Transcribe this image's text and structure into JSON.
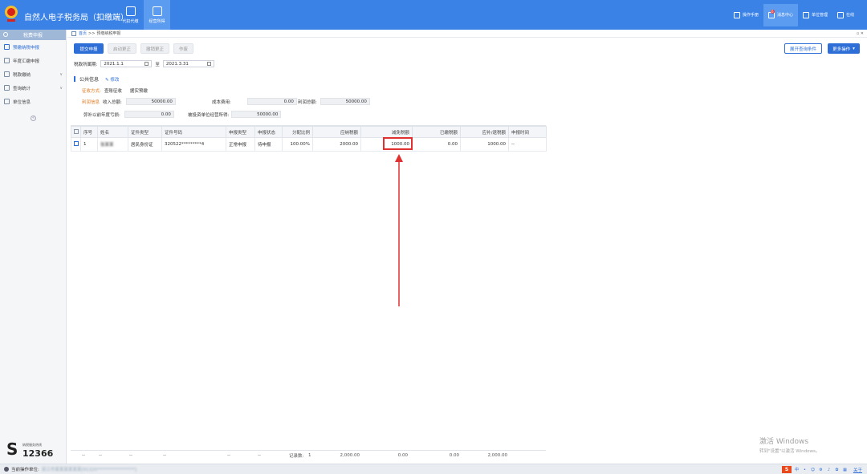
{
  "app": {
    "title": "自然人电子税务局（扣缴端）"
  },
  "topnav": [
    {
      "label": "代扣代缴",
      "icon": "document-icon"
    },
    {
      "label": "经营所得",
      "icon": "box-icon"
    }
  ],
  "topright": [
    {
      "label": "操作手册",
      "icon": "book-icon"
    },
    {
      "label": "消息中心",
      "icon": "mail-icon",
      "badge": "6"
    },
    {
      "label": "单位管理",
      "icon": "building-icon"
    },
    {
      "label": "在线",
      "icon": "chat-icon"
    }
  ],
  "sidebar": {
    "header": "税费申报",
    "items": [
      {
        "label": "预缴纳税申报",
        "active": true
      },
      {
        "label": "年度汇缴申报"
      },
      {
        "label": "税款缴纳",
        "arrow": "∨"
      },
      {
        "label": "查询统计",
        "arrow": "∨"
      },
      {
        "label": "单位信息"
      }
    ],
    "collapse": "«"
  },
  "hotline": {
    "small": "纳税服务热线",
    "number": "12366",
    "s": "S"
  },
  "breadcrumb": {
    "home": "首页",
    "sep": ">>",
    "current": "预缴纳税申报"
  },
  "window_controls": "▫ ✕",
  "toolbar": {
    "submit": "提交申报",
    "start_correct": "启动更正",
    "cancel_correct": "撤销更正",
    "void": "作废",
    "expand_query": "展开查询条件",
    "more": "更多操作"
  },
  "period": {
    "label": "税款所属期:",
    "from": "2021.1.1",
    "to_label": "至",
    "to": "2021.3.31"
  },
  "public_info": {
    "title": "公共信息",
    "edit": "修改",
    "levy_label": "征收方式:",
    "levy_value": "查账征收",
    "levy_sub": "据实预缴",
    "profit_label": "利润信息",
    "income_label": "收入总额:",
    "income_value": "50000.00",
    "cost_label": "成本费用:",
    "cost_value": "0.00",
    "profit_total_label": "利润总额:",
    "profit_total_value": "50000.00",
    "loss_label": "弥补以前年度亏损:",
    "loss_value": "0.00",
    "invest_label": "被投资单位经营所得:",
    "invest_value": "50000.00"
  },
  "table": {
    "headers": [
      "序号",
      "姓名",
      "证件类型",
      "证件号码",
      "申报类型",
      "申报状态",
      "分配比例",
      "应纳税额",
      "减免税额",
      "已缴税额",
      "应补/退税额",
      "申报时间"
    ],
    "rows": [
      {
        "index": "1",
        "name": "张某某",
        "id_type": "居民身份证",
        "id_no": "320522*********4",
        "decl_type": "正常申报",
        "status": "待申报",
        "ratio": "100.00%",
        "payable": "2000.00",
        "relief": "1000.00",
        "paid": "0.00",
        "refund": "1000.00",
        "time": "--"
      }
    ]
  },
  "footer": {
    "dash": "--",
    "records_label": "记录数:",
    "records": "1",
    "payable": "2,000.00",
    "relief": "0.00",
    "paid": "0.00",
    "refund": "2,000.00"
  },
  "watermark": {
    "line1": "激活 Windows",
    "line2": "转到\"设置\"以激活 Windows。"
  },
  "status": {
    "label": "当前操作单位:",
    "unit": "吴江市某某某某某某[91320*****************]",
    "about": "关于"
  },
  "colors": {
    "accent": "#3a82e6",
    "primary": "#2d6fd6",
    "highlight": "#e03030"
  }
}
